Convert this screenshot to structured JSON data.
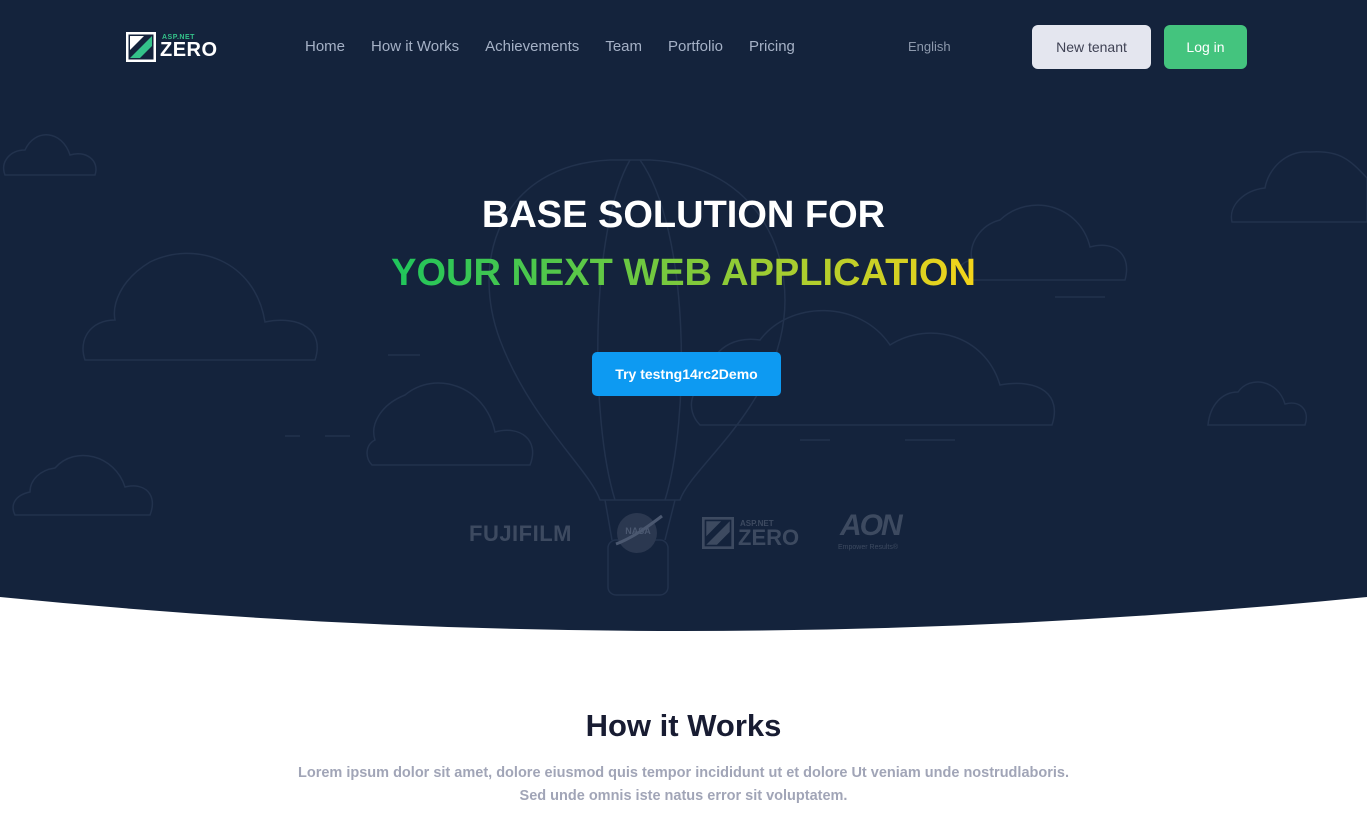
{
  "brand": {
    "small_text": "ASP.NET",
    "big_text": "ZERO",
    "accent": "#34c28a"
  },
  "nav": {
    "items": [
      "Home",
      "How it Works",
      "Achievements",
      "Team",
      "Portfolio",
      "Pricing"
    ]
  },
  "language": "English",
  "actions": {
    "new_tenant_label": "New tenant",
    "login_label": "Log in"
  },
  "hero": {
    "line1": "BASE SOLUTION FOR",
    "line2": "YOUR NEXT WEB APPLICATION",
    "cta_label": "Try testng14rc2Demo",
    "background": "#14233c",
    "gradient": [
      "#1fc55c",
      "#7cc93c",
      "#f4d41a"
    ]
  },
  "partners": {
    "fujifilm": "FUJIFILM",
    "nasa": "NASA",
    "aspnet_small": "ASP.NET",
    "aspnet_big": "ZERO",
    "aon": "AON",
    "aon_tagline": "Empower Results®"
  },
  "how_it_works": {
    "title": "How it Works",
    "description_line1": "Lorem ipsum dolor sit amet, dolore eiusmod quis tempor incididunt ut et dolore Ut veniam unde nostrudlaboris.",
    "description_line2": "Sed unde omnis iste natus error sit voluptatem."
  }
}
